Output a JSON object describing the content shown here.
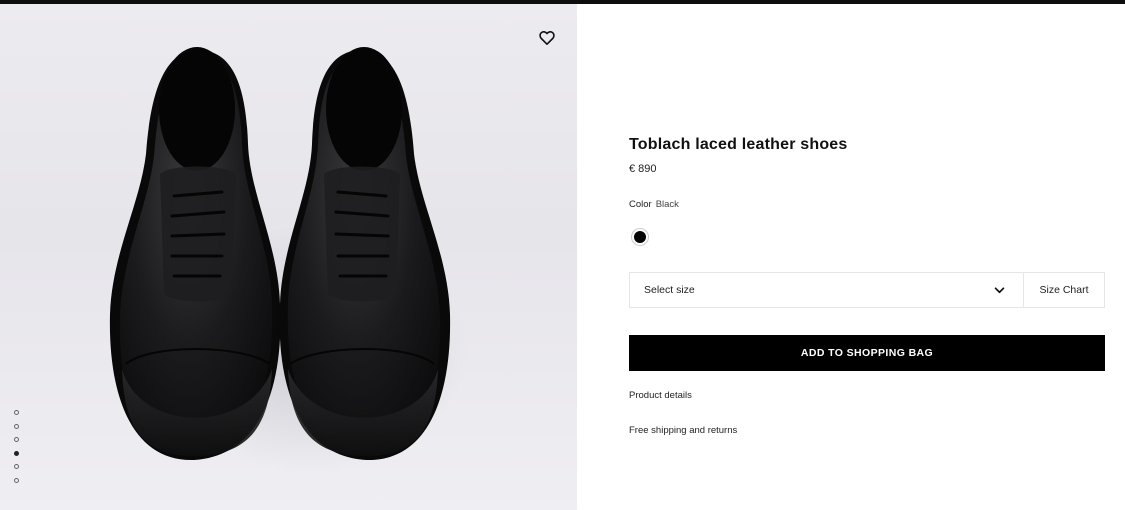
{
  "product": {
    "title": "Toblach laced leather shoes",
    "price": "€ 890",
    "color_label": "Color",
    "color_value": "Black",
    "swatch_color": "#050505"
  },
  "size": {
    "placeholder": "Select size",
    "chart_label": "Size Chart"
  },
  "actions": {
    "add_to_bag": "ADD TO SHOPPING BAG",
    "product_details": "Product details",
    "shipping": "Free shipping and returns"
  },
  "gallery": {
    "image_count": 6,
    "active_index": 3,
    "wishlist_icon": "heart-icon"
  }
}
